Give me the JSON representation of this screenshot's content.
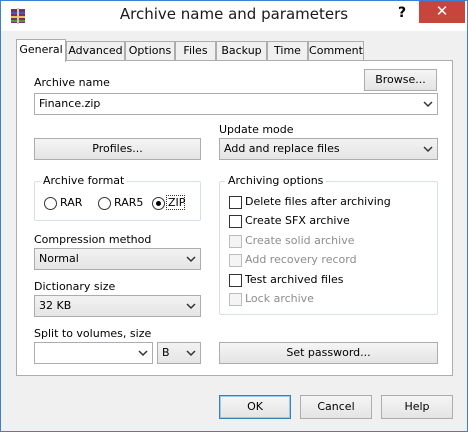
{
  "window": {
    "title": "Archive name and parameters",
    "help_symbol": "?",
    "close_symbol": "✕"
  },
  "tabs": [
    "General",
    "Advanced",
    "Options",
    "Files",
    "Backup",
    "Time",
    "Comment"
  ],
  "active_tab": "General",
  "archive_name": {
    "label": "Archive name",
    "value": "Finance.zip",
    "browse_label": "Browse..."
  },
  "profiles_label": "Profiles...",
  "update_mode": {
    "label": "Update mode",
    "value": "Add and replace files"
  },
  "archive_format": {
    "label": "Archive format",
    "options": [
      "RAR",
      "RAR5",
      "ZIP"
    ],
    "selected": "ZIP"
  },
  "compression_method": {
    "label": "Compression method",
    "value": "Normal"
  },
  "dictionary_size": {
    "label": "Dictionary size",
    "value": "32 KB"
  },
  "split_volumes": {
    "label": "Split to volumes, size",
    "value": "",
    "unit": "B"
  },
  "archiving_options": {
    "label": "Archiving options",
    "items": [
      {
        "label": "Delete files after archiving",
        "checked": false,
        "enabled": true
      },
      {
        "label": "Create SFX archive",
        "checked": false,
        "enabled": true
      },
      {
        "label": "Create solid archive",
        "checked": false,
        "enabled": false
      },
      {
        "label": "Add recovery record",
        "checked": false,
        "enabled": false
      },
      {
        "label": "Test archived files",
        "checked": false,
        "enabled": true
      },
      {
        "label": "Lock archive",
        "checked": false,
        "enabled": false
      }
    ]
  },
  "set_password_label": "Set password...",
  "buttons": {
    "ok": "OK",
    "cancel": "Cancel",
    "help": "Help"
  },
  "colors": {
    "close_button": "#c7453b",
    "window_border": "#3b7fd6",
    "disabled_text": "#8d8d8d"
  }
}
